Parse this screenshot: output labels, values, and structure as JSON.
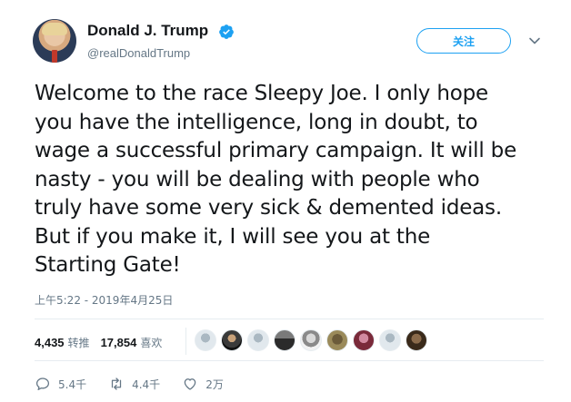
{
  "user": {
    "display_name": "Donald J. Trump",
    "handle": "@realDonaldTrump",
    "verified": true
  },
  "header": {
    "follow_label": "关注",
    "menu_icon": "chevron-down-icon"
  },
  "tweet": {
    "text": "Welcome to the race Sleepy Joe. I only hope\nyou have the intelligence, long in doubt, to\nwage a successful primary campaign. It will be\nnasty - you will be dealing with people who\ntruly have some very sick & demented ideas.\nBut if you make it, I will see you at the\nStarting Gate!",
    "timestamp": "上午5:22 - 2019年4月25日"
  },
  "stats": {
    "retweets_count": "4,435",
    "retweets_label": "转推",
    "likes_count": "17,854",
    "likes_label": "喜欢"
  },
  "likers": [
    {
      "icon": "default-avatar"
    },
    {
      "icon": "dark-avatar"
    },
    {
      "icon": "default-avatar"
    },
    {
      "icon": "dark-avatar"
    },
    {
      "icon": "grey-avatar"
    },
    {
      "icon": "olive-avatar"
    },
    {
      "icon": "pink-avatar"
    },
    {
      "icon": "default-avatar"
    },
    {
      "icon": "brown-avatar"
    }
  ],
  "actions": {
    "reply_count": "5.4千",
    "retweet_count": "4.4千",
    "like_count": "2万"
  },
  "colors": {
    "accent": "#1da1f2",
    "text": "#14171a",
    "muted": "#657786",
    "divider": "#e6ecf0"
  }
}
